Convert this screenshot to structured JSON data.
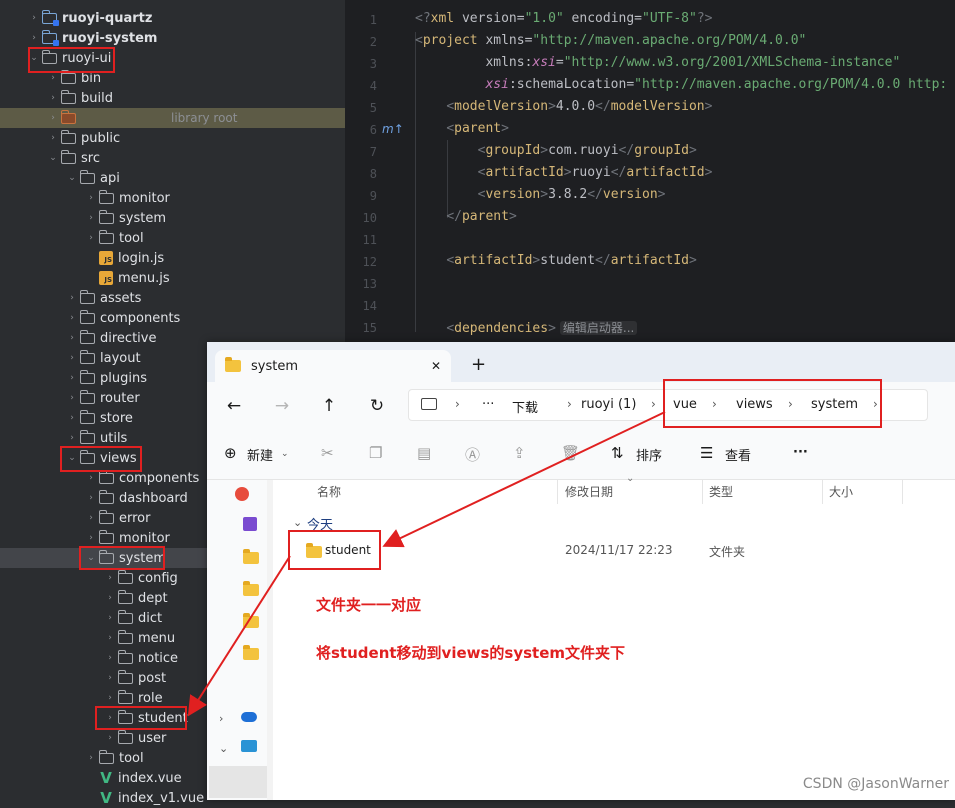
{
  "project_tree": {
    "rows": [
      {
        "label": "ruoyi-quartz",
        "bold": true,
        "icon": "module-folder-icon",
        "chev": "right"
      },
      {
        "label": "ruoyi-system",
        "bold": true,
        "icon": "module-folder-icon",
        "chev": "right"
      },
      {
        "label": "ruoyi-ui",
        "icon": "folder-icon",
        "chev": "down"
      },
      {
        "label": "bin",
        "icon": "folder-icon",
        "chev": "right"
      },
      {
        "label": "build",
        "icon": "folder-icon",
        "chev": "right"
      },
      {
        "label": "",
        "suffix": "library root",
        "icon": "excluded-folder-icon",
        "chev": "right"
      },
      {
        "label": "public",
        "icon": "folder-icon",
        "chev": "right"
      },
      {
        "label": "src",
        "icon": "folder-icon",
        "chev": "down"
      },
      {
        "label": "api",
        "icon": "folder-icon",
        "chev": "down"
      },
      {
        "label": "monitor",
        "icon": "folder-icon",
        "chev": "right"
      },
      {
        "label": "system",
        "icon": "folder-icon",
        "chev": "right"
      },
      {
        "label": "tool",
        "icon": "folder-icon",
        "chev": "right"
      },
      {
        "label": "login.js",
        "icon": "js-file-icon",
        "chev": "none"
      },
      {
        "label": "menu.js",
        "icon": "js-file-icon",
        "chev": "none"
      },
      {
        "label": "assets",
        "icon": "folder-icon",
        "chev": "right"
      },
      {
        "label": "components",
        "icon": "folder-icon",
        "chev": "right"
      },
      {
        "label": "directive",
        "icon": "folder-icon",
        "chev": "right"
      },
      {
        "label": "layout",
        "icon": "folder-icon",
        "chev": "right"
      },
      {
        "label": "plugins",
        "icon": "folder-icon",
        "chev": "right"
      },
      {
        "label": "router",
        "icon": "folder-icon",
        "chev": "right"
      },
      {
        "label": "store",
        "icon": "folder-icon",
        "chev": "right"
      },
      {
        "label": "utils",
        "icon": "folder-icon",
        "chev": "right"
      },
      {
        "label": "views",
        "icon": "folder-icon",
        "chev": "down"
      },
      {
        "label": "components",
        "icon": "folder-icon",
        "chev": "right"
      },
      {
        "label": "dashboard",
        "icon": "folder-icon",
        "chev": "right"
      },
      {
        "label": "error",
        "icon": "folder-icon",
        "chev": "right"
      },
      {
        "label": "monitor",
        "icon": "folder-icon",
        "chev": "right"
      },
      {
        "label": "system",
        "icon": "folder-icon",
        "chev": "down",
        "selected": true
      },
      {
        "label": "config",
        "icon": "folder-icon",
        "chev": "right"
      },
      {
        "label": "dept",
        "icon": "folder-icon",
        "chev": "right"
      },
      {
        "label": "dict",
        "icon": "folder-icon",
        "chev": "right"
      },
      {
        "label": "menu",
        "icon": "folder-icon",
        "chev": "right"
      },
      {
        "label": "notice",
        "icon": "folder-icon",
        "chev": "right"
      },
      {
        "label": "post",
        "icon": "folder-icon",
        "chev": "right"
      },
      {
        "label": "role",
        "icon": "folder-icon",
        "chev": "right"
      },
      {
        "label": "student",
        "icon": "folder-icon",
        "chev": "right"
      },
      {
        "label": "user",
        "icon": "folder-icon",
        "chev": "right"
      },
      {
        "label": "tool",
        "icon": "folder-icon",
        "chev": "right"
      },
      {
        "label": "index.vue",
        "icon": "vue-file-icon",
        "chev": "none"
      },
      {
        "label": "index_v1.vue",
        "icon": "vue-file-icon",
        "chev": "none"
      }
    ]
  },
  "editor": {
    "line_numbers": [
      "1",
      "2",
      "3",
      "4",
      "5",
      "6",
      "7",
      "8",
      "9",
      "10",
      "11",
      "12",
      "13",
      "14",
      "15"
    ],
    "gutter_marker": "m↑",
    "lines": [
      {
        "parts": [
          [
            "b",
            "<?"
          ],
          [
            "t",
            "xml "
          ],
          [
            "a",
            "version="
          ],
          [
            "s",
            "\"1.0\""
          ],
          [
            "a",
            " encoding="
          ],
          [
            "s",
            "\"UTF-8\""
          ],
          [
            "b",
            "?>"
          ]
        ]
      },
      {
        "parts": [
          [
            "b",
            "<"
          ],
          [
            "t",
            "project "
          ],
          [
            "a",
            "xmlns="
          ],
          [
            "s",
            "\"http://maven.apache.org/POM/4.0.0\""
          ]
        ]
      },
      {
        "parts": [
          [
            "a",
            "         xmlns:"
          ],
          [
            "n",
            "xsi"
          ],
          [
            "a",
            "="
          ],
          [
            "s",
            "\"http://www.w3.org/2001/XMLSchema-instance\""
          ]
        ]
      },
      {
        "parts": [
          [
            "a",
            "         "
          ],
          [
            "n",
            "xsi"
          ],
          [
            "a",
            ":schemaLocation="
          ],
          [
            "s",
            "\"http://maven.apache.org/POM/4.0.0 http:"
          ]
        ]
      },
      {
        "parts": [
          [
            "a",
            "    "
          ],
          [
            "b",
            "<"
          ],
          [
            "t",
            "modelVersion"
          ],
          [
            "b",
            ">"
          ],
          [
            "a",
            "4.0.0"
          ],
          [
            "b",
            "</"
          ],
          [
            "t",
            "modelVersion"
          ],
          [
            "b",
            ">"
          ]
        ]
      },
      {
        "parts": [
          [
            "a",
            "    "
          ],
          [
            "b",
            "<"
          ],
          [
            "t",
            "parent"
          ],
          [
            "b",
            ">"
          ]
        ]
      },
      {
        "parts": [
          [
            "a",
            "        "
          ],
          [
            "b",
            "<"
          ],
          [
            "t",
            "groupId"
          ],
          [
            "b",
            ">"
          ],
          [
            "a",
            "com.ruoyi"
          ],
          [
            "b",
            "</"
          ],
          [
            "t",
            "groupId"
          ],
          [
            "b",
            ">"
          ]
        ]
      },
      {
        "parts": [
          [
            "a",
            "        "
          ],
          [
            "b",
            "<"
          ],
          [
            "t",
            "artifactId"
          ],
          [
            "b",
            ">"
          ],
          [
            "a",
            "ruoyi"
          ],
          [
            "b",
            "</"
          ],
          [
            "t",
            "artifactId"
          ],
          [
            "b",
            ">"
          ]
        ]
      },
      {
        "parts": [
          [
            "a",
            "        "
          ],
          [
            "b",
            "<"
          ],
          [
            "t",
            "version"
          ],
          [
            "b",
            ">"
          ],
          [
            "a",
            "3.8.2"
          ],
          [
            "b",
            "</"
          ],
          [
            "t",
            "version"
          ],
          [
            "b",
            ">"
          ]
        ]
      },
      {
        "parts": [
          [
            "a",
            "    "
          ],
          [
            "b",
            "</"
          ],
          [
            "t",
            "parent"
          ],
          [
            "b",
            ">"
          ]
        ]
      },
      {
        "parts": []
      },
      {
        "parts": [
          [
            "a",
            "    "
          ],
          [
            "b",
            "<"
          ],
          [
            "t",
            "artifactId"
          ],
          [
            "b",
            ">"
          ],
          [
            "a",
            "student"
          ],
          [
            "b",
            "</"
          ],
          [
            "t",
            "artifactId"
          ],
          [
            "b",
            ">"
          ]
        ]
      },
      {
        "parts": []
      },
      {
        "parts": []
      },
      {
        "parts": [
          [
            "a",
            "    "
          ],
          [
            "b",
            "<"
          ],
          [
            "t",
            "dependencies"
          ],
          [
            "b",
            ">"
          ]
        ]
      }
    ],
    "inlay_hint": "编辑启动器..."
  },
  "explorer": {
    "tab_title": "system",
    "tab_close": "✕",
    "new_tab": "+",
    "breadcrumbs": [
      "下载",
      "ruoyi (1)",
      "vue",
      "views",
      "system"
    ],
    "more": "···",
    "toolbar": {
      "new_label": "新建",
      "sort_label": "排序",
      "view_label": "查看",
      "more": "···"
    },
    "columns": [
      "名称",
      "修改日期",
      "类型",
      "大小"
    ],
    "group_label": "今天",
    "item": {
      "name": "student",
      "date": "2024/11/17 22:23",
      "type": "文件夹"
    }
  },
  "annotations": {
    "line1": "文件夹一一对应",
    "line2": "将student移动到views的system文件夹下"
  },
  "watermark": "CSDN @JasonWarner",
  "colors": {
    "annotation_red": "#e02020",
    "selection": "#43454a",
    "ide_bg": "#2b2d30"
  }
}
